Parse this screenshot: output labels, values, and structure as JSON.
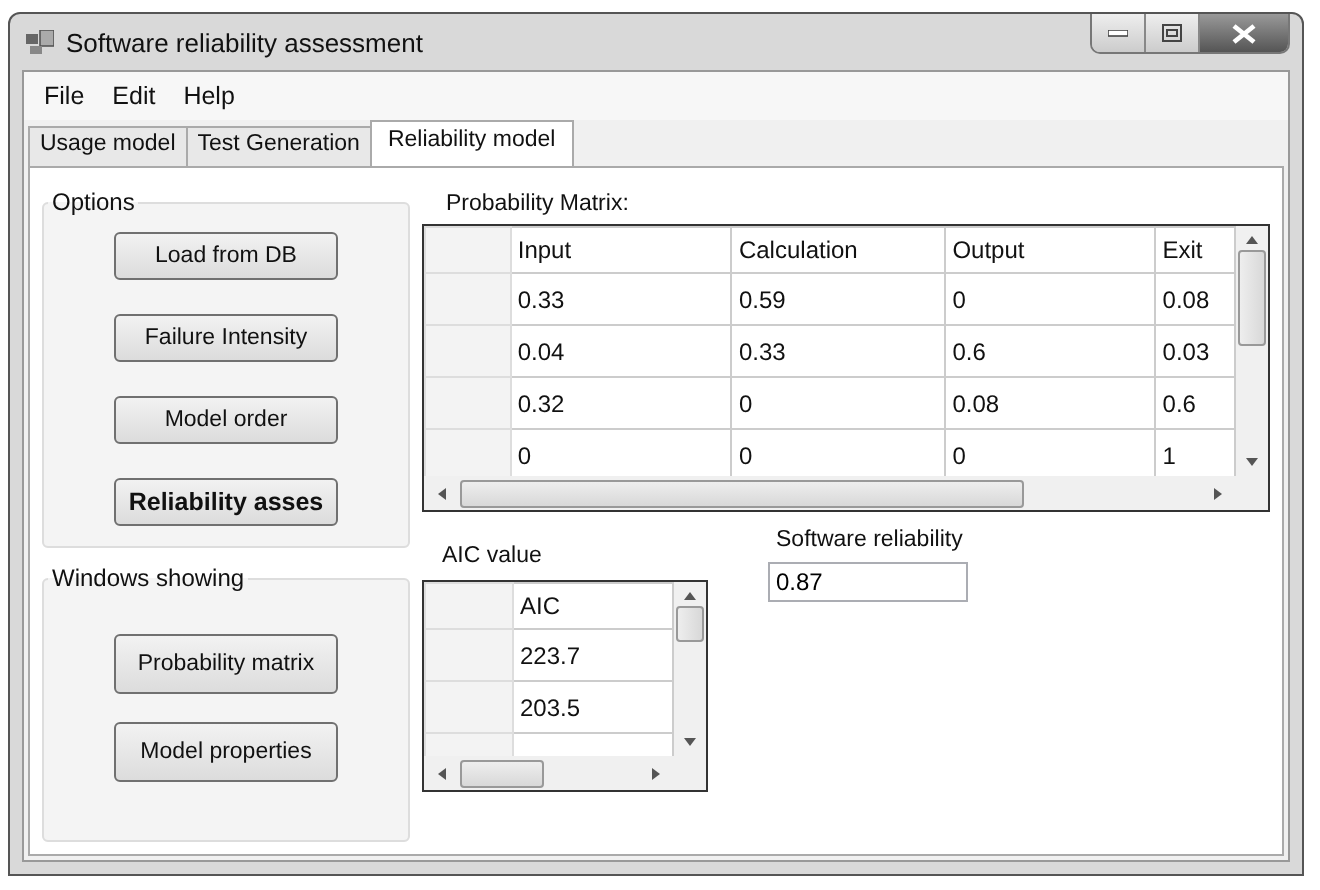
{
  "window": {
    "title": "Software reliability assessment"
  },
  "menu": [
    {
      "label": "File"
    },
    {
      "label": "Edit"
    },
    {
      "label": "Help"
    }
  ],
  "tabs": [
    {
      "label": "Usage model",
      "selected": false
    },
    {
      "label": "Test Generation",
      "selected": false
    },
    {
      "label": "Reliability model",
      "selected": true
    }
  ],
  "options": {
    "title": "Options",
    "buttons": [
      {
        "label": "Load from DB",
        "emphasized": false
      },
      {
        "label": "Failure Intensity",
        "emphasized": false
      },
      {
        "label": "Model order",
        "emphasized": false
      },
      {
        "label": "Reliability asses",
        "emphasized": true
      }
    ]
  },
  "windows_showing": {
    "title": "Windows showing",
    "buttons": [
      {
        "label": "Probability matrix",
        "emphasized": false
      },
      {
        "label": "Model properties",
        "emphasized": false
      }
    ]
  },
  "probability_matrix": {
    "label": "Probability Matrix:",
    "columns": [
      "Input",
      "Calculation",
      "Output",
      "Exit"
    ],
    "rows": [
      [
        "0.33",
        "0.59",
        "0",
        "0.08"
      ],
      [
        "0.04",
        "0.33",
        "0.6",
        "0.03"
      ],
      [
        "0.32",
        "0",
        "0.08",
        "0.6"
      ],
      [
        "0",
        "0",
        "0",
        "1"
      ]
    ]
  },
  "aic": {
    "label": "AIC value",
    "columns": [
      "AIC"
    ],
    "rows": [
      [
        "223.7"
      ],
      [
        "203.5"
      ]
    ]
  },
  "software_reliability": {
    "label": "Software reliability",
    "value": "0.87"
  }
}
